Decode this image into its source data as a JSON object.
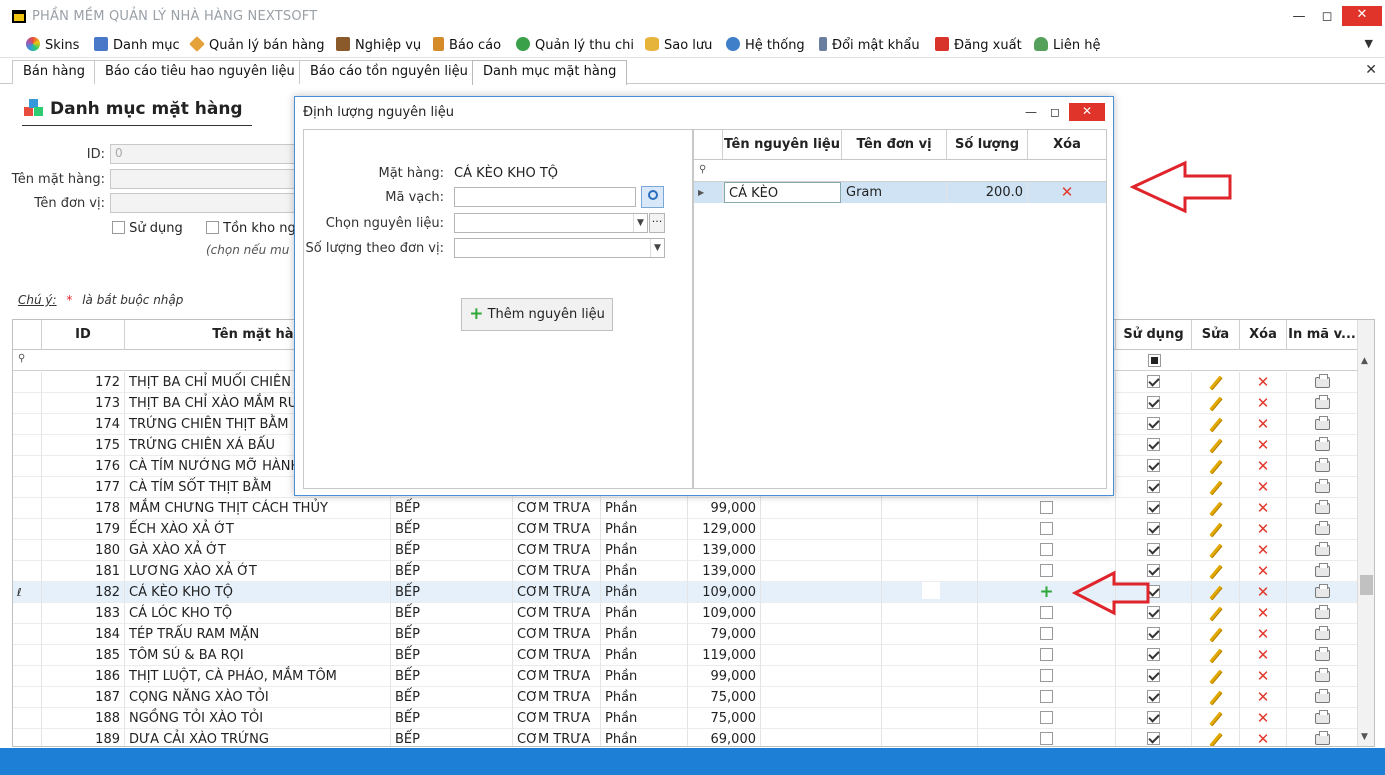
{
  "window": {
    "title": "PHẦN MỀM QUẢN LÝ NHÀ HÀNG NEXTSOFT",
    "minimize": "—",
    "maximize": "◻",
    "close": "✕"
  },
  "menu": [
    {
      "label": "Skins",
      "icon": "skins-icon",
      "color": "#c04ad1"
    },
    {
      "label": "Danh mục",
      "icon": "grid-icon",
      "color": "#4a78c9"
    },
    {
      "label": "Quản lý bán hàng",
      "icon": "tag-icon",
      "color": "#e5a23b"
    },
    {
      "label": "Nghiệp vụ",
      "icon": "briefcase-icon",
      "color": "#8a5a2b"
    },
    {
      "label": "Báo cáo",
      "icon": "clipboard-icon",
      "color": "#d58b2a"
    },
    {
      "label": "Quản lý thu chi",
      "icon": "money-icon",
      "color": "#3aa04a"
    },
    {
      "label": "Sao lưu",
      "icon": "database-icon",
      "color": "#e6b43a"
    },
    {
      "label": "Hệ thống",
      "icon": "gears-icon",
      "color": "#3f7fc9"
    },
    {
      "label": "Đổi mật khẩu",
      "icon": "key-icon",
      "color": "#6a7fa0"
    },
    {
      "label": "Đăng xuất",
      "icon": "logout-icon",
      "color": "#d9342b"
    },
    {
      "label": "Liên hệ",
      "icon": "user-icon",
      "color": "#55a05a"
    }
  ],
  "tabs": [
    {
      "label": "Bán hàng"
    },
    {
      "label": "Báo cáo tiêu hao nguyên liệu"
    },
    {
      "label": "Báo cáo tồn nguyên liệu"
    },
    {
      "label": "Danh mục mặt hàng"
    }
  ],
  "tab_close_all": "✕",
  "page": {
    "title": "Danh mục mặt hàng",
    "fields": {
      "id_label": "ID:",
      "id_value": "0",
      "name_label": "Tên mặt hàng:",
      "unit_label": "Tên đơn vị:",
      "use_label": "Sử dụng",
      "stock_label": "Tồn kho ng",
      "hint": "(chọn nếu mu"
    },
    "note_label": "Chú ý:",
    "note_star": "*",
    "note_text": "là bắt buộc nhập"
  },
  "grid": {
    "headers": {
      "id": "ID",
      "name": "Tên mặt hàn",
      "use": "Sử dụng",
      "edit": "Sửa",
      "delete": "Xóa",
      "print": "In mã v..."
    },
    "rows": [
      {
        "id": "172",
        "name": "THỊT BA CHỈ MUỐI CHIÊN",
        "kitchen": "",
        "menu": "",
        "unit": "",
        "price": "",
        "addable": false
      },
      {
        "id": "173",
        "name": "THỊT BA CHỈ XÀO MẮM RUỐ",
        "kitchen": "",
        "menu": "",
        "unit": "",
        "price": "",
        "addable": false
      },
      {
        "id": "174",
        "name": "TRỨNG CHIÊN THỊT BẰM",
        "kitchen": "",
        "menu": "",
        "unit": "",
        "price": "",
        "addable": false
      },
      {
        "id": "175",
        "name": "TRỨNG CHIÊN XÁ BẤU",
        "kitchen": "",
        "menu": "",
        "unit": "",
        "price": "",
        "addable": false
      },
      {
        "id": "176",
        "name": "CÀ TÍM NƯỚNG MỠ HÀNH",
        "kitchen": "",
        "menu": "",
        "unit": "",
        "price": "",
        "addable": false
      },
      {
        "id": "177",
        "name": "CÀ TÍM SỐT THỊT BẰM",
        "kitchen": "",
        "menu": "",
        "unit": "",
        "price": "",
        "addable": false
      },
      {
        "id": "178",
        "name": "MẮM CHƯNG THỊT CÁCH THỦY",
        "kitchen": "BẾP",
        "menu": "CƠM TRƯA",
        "unit": "Phần",
        "price": "99,000",
        "addable": false
      },
      {
        "id": "179",
        "name": "ẾCH XÀO XẢ ỚT",
        "kitchen": "BẾP",
        "menu": "CƠM TRƯA",
        "unit": "Phần",
        "price": "129,000",
        "addable": false
      },
      {
        "id": "180",
        "name": "GÀ XÀO XẢ ỚT",
        "kitchen": "BẾP",
        "menu": "CƠM TRƯA",
        "unit": "Phần",
        "price": "139,000",
        "addable": false
      },
      {
        "id": "181",
        "name": "LƯƠNG XÀO XẢ ỚT",
        "kitchen": "BẾP",
        "menu": "CƠM TRƯA",
        "unit": "Phần",
        "price": "139,000",
        "addable": false
      },
      {
        "id": "182",
        "name": "CÁ KÈO KHO TỘ",
        "kitchen": "BẾP",
        "menu": "CƠM TRƯA",
        "unit": "Phần",
        "price": "109,000",
        "addable": true
      },
      {
        "id": "183",
        "name": "CÁ LÓC KHO TỘ",
        "kitchen": "BẾP",
        "menu": "CƠM TRƯA",
        "unit": "Phần",
        "price": "109,000",
        "addable": false
      },
      {
        "id": "184",
        "name": "TÉP TRẤU RAM MẶN",
        "kitchen": "BẾP",
        "menu": "CƠM TRƯA",
        "unit": "Phần",
        "price": "79,000",
        "addable": false
      },
      {
        "id": "185",
        "name": "TÔM SÚ & BA RỌI",
        "kitchen": "BẾP",
        "menu": "CƠM TRƯA",
        "unit": "Phần",
        "price": "119,000",
        "addable": false
      },
      {
        "id": "186",
        "name": "THỊT LUỘT, CÀ PHÁO, MẮM TÔM",
        "kitchen": "BẾP",
        "menu": "CƠM TRƯA",
        "unit": "Phần",
        "price": "99,000",
        "addable": false
      },
      {
        "id": "187",
        "name": "CỌNG NĂNG XÀO TỎI",
        "kitchen": "BẾP",
        "menu": "CƠM TRƯA",
        "unit": "Phần",
        "price": "75,000",
        "addable": false
      },
      {
        "id": "188",
        "name": "NGỒNG TỎI XÀO TỎI",
        "kitchen": "BẾP",
        "menu": "CƠM TRƯA",
        "unit": "Phần",
        "price": "75,000",
        "addable": false
      },
      {
        "id": "189",
        "name": "DƯA CẢI XÀO TRỨNG",
        "kitchen": "BẾP",
        "menu": "CƠM TRƯA",
        "unit": "Phần",
        "price": "69,000",
        "addable": false
      }
    ],
    "selected_row_id": "182",
    "edit_marker": "ℓ"
  },
  "dialog": {
    "title": "Định lượng nguyên liệu",
    "minimize": "—",
    "maximize": "◻",
    "close": "✕",
    "item_label": "Mặt hàng:",
    "item_value": "CÁ KÈO KHO TỘ",
    "barcode_label": "Mã vạch:",
    "ingredient_label": "Chọn nguyên liệu:",
    "qty_label": "Số lượng theo đơn vị:",
    "add_button": "Thêm nguyên liệu",
    "table": {
      "headers": {
        "name": "Tên nguyên liệu",
        "unit": "Tên đơn vị",
        "qty": "Số lượng",
        "delete": "Xóa"
      },
      "rows": [
        {
          "name": "CÁ KÈO",
          "unit": "Gram",
          "qty": "200.0"
        }
      ]
    }
  },
  "annotation_color": "#e0242b",
  "status_color": "#1e7fd6"
}
